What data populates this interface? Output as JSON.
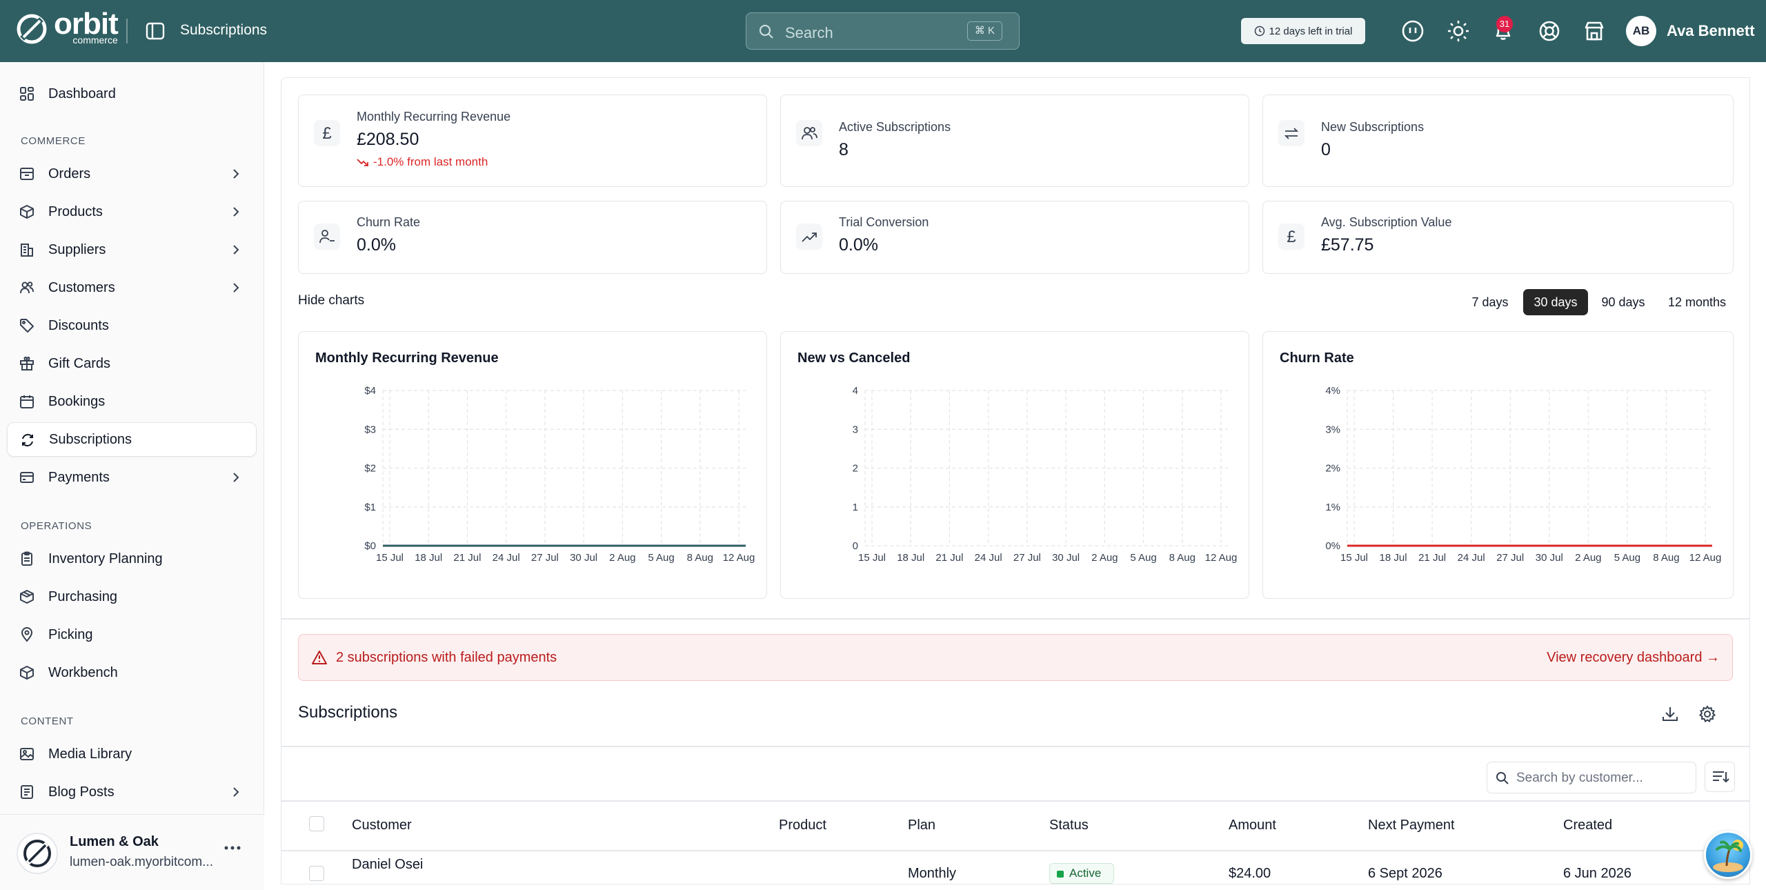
{
  "app": {
    "brand": "orbit",
    "brand_sub": "commerce",
    "page_title": "Subscriptions",
    "search_placeholder": "Search",
    "search_shortcut": "⌘ K",
    "trial_text": "12 days left in trial",
    "notification_count": "31",
    "user_initials": "AB",
    "user_name": "Ava Bennett"
  },
  "sidebar": {
    "dashboard": "Dashboard",
    "commerce_label": "COMMERCE",
    "commerce": [
      "Orders",
      "Products",
      "Suppliers",
      "Customers",
      "Discounts",
      "Gift Cards",
      "Bookings",
      "Subscriptions",
      "Payments"
    ],
    "operations_label": "OPERATIONS",
    "operations": [
      "Inventory Planning",
      "Purchasing",
      "Picking",
      "Workbench"
    ],
    "content_label": "CONTENT",
    "content": [
      "Media Library",
      "Blog Posts"
    ],
    "store": {
      "name": "Lumen & Oak",
      "url": "lumen-oak.myorbitcom..."
    }
  },
  "stats": [
    {
      "label": "Monthly Recurring Revenue",
      "value": "£208.50",
      "delta": "-1.0% from last month"
    },
    {
      "label": "Active Subscriptions",
      "value": "8"
    },
    {
      "label": "New Subscriptions",
      "value": "0"
    },
    {
      "label": "Churn Rate",
      "value": "0.0%"
    },
    {
      "label": "Trial Conversion",
      "value": "0.0%"
    },
    {
      "label": "Avg. Subscription Value",
      "value": "£57.75"
    }
  ],
  "charts_toggle": "Hide charts",
  "ranges": [
    "7 days",
    "30 days",
    "90 days",
    "12 months"
  ],
  "selected_range": "30 days",
  "chart_data": [
    {
      "type": "line",
      "title": "Monthly Recurring Revenue",
      "x": [
        "15 Jul",
        "18 Jul",
        "21 Jul",
        "24 Jul",
        "27 Jul",
        "30 Jul",
        "2 Aug",
        "5 Aug",
        "8 Aug",
        "12 Aug"
      ],
      "y_ticks": [
        "$0",
        "$1",
        "$2",
        "$3",
        "$4"
      ],
      "ylim": [
        0,
        4
      ],
      "series": [
        {
          "values": [
            0,
            0,
            0,
            0,
            0,
            0,
            0,
            0,
            0,
            0
          ]
        }
      ],
      "grid": true,
      "color": "#2f5f62"
    },
    {
      "type": "line",
      "title": "New vs Canceled",
      "x": [
        "15 Jul",
        "18 Jul",
        "21 Jul",
        "24 Jul",
        "27 Jul",
        "30 Jul",
        "2 Aug",
        "5 Aug",
        "8 Aug",
        "12 Aug"
      ],
      "y_ticks": [
        "0",
        "1",
        "2",
        "3",
        "4"
      ],
      "ylim": [
        0,
        4
      ],
      "series": [],
      "grid": true
    },
    {
      "type": "line",
      "title": "Churn Rate",
      "x": [
        "15 Jul",
        "18 Jul",
        "21 Jul",
        "24 Jul",
        "27 Jul",
        "30 Jul",
        "2 Aug",
        "5 Aug",
        "8 Aug",
        "12 Aug"
      ],
      "y_ticks": [
        "0%",
        "1%",
        "2%",
        "3%",
        "4%"
      ],
      "ylim": [
        0,
        4
      ],
      "series": [
        {
          "values": [
            0,
            0,
            0,
            0,
            0,
            0,
            0,
            0,
            0,
            0
          ]
        }
      ],
      "grid": true,
      "color": "#dc2626"
    }
  ],
  "alert": {
    "text": "2 subscriptions with failed payments",
    "link": "View recovery dashboard →"
  },
  "table": {
    "title": "Subscriptions",
    "search_placeholder": "Search by customer...",
    "columns": [
      "Customer",
      "Product",
      "Plan",
      "Status",
      "Amount",
      "Next Payment",
      "Created"
    ],
    "rows": [
      {
        "customer": "Daniel Osei",
        "product": "",
        "plan": "Monthly",
        "status": "Active",
        "amount": "$24.00",
        "next_payment": "6 Sept 2026",
        "created": "6 Jun 2026"
      }
    ]
  }
}
